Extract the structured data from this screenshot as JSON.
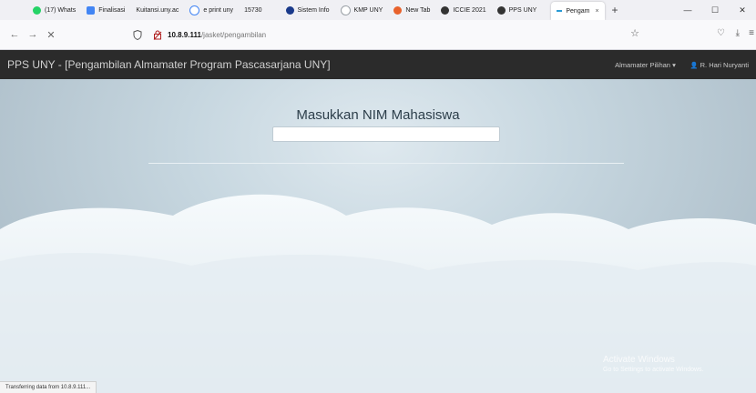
{
  "browser": {
    "tabs": [
      {
        "label": "(17) Whats",
        "color": "#25d366"
      },
      {
        "label": "Finalisasi",
        "color": "#4285f4"
      },
      {
        "label": "Kuitansi.uny.ac",
        "color": "#9aa0a6"
      },
      {
        "label": "e print uny",
        "color": "#4285f4"
      },
      {
        "label": "15730",
        "color": "#9aa0a6"
      },
      {
        "label": "Sistem Info",
        "color": "#1a3a8a"
      },
      {
        "label": "KMP UNY",
        "color": "#9aa0a6"
      },
      {
        "label": "New Tab",
        "color": "#e8622c"
      },
      {
        "label": "ICCIE 2021",
        "color": "#333333"
      },
      {
        "label": "PPS UNY",
        "color": "#333333"
      },
      {
        "label": "Pengam",
        "color": "#2a9bd5"
      }
    ],
    "tab_close": "×",
    "new_tab": "+",
    "window_controls": {
      "minimize": "—",
      "maximize": "☐",
      "close": "✕"
    },
    "nav": {
      "back": "←",
      "forward": "→",
      "stop": "✕"
    },
    "url_host": "10.8.9.111",
    "url_path": "/jasket/pengambilan",
    "bookmark_star": "☆",
    "pocket_icon": "♡",
    "download_icon": "⤓",
    "menu_icon": "≡"
  },
  "app": {
    "brand": "PPS UNY - [Pengambilan Almamater Program Pascasarjana UNY]",
    "menu_almamater": "Almamater Pilihan",
    "caret": "▾",
    "user_icon": "👤",
    "user_name": "R. Hari Nuryanti"
  },
  "main": {
    "title": "Masukkan NIM Mahasiswa",
    "nim_value": ""
  },
  "overlay": {
    "activate_title": "Activate Windows",
    "activate_sub": "Go to Settings to activate Windows."
  },
  "status_bar": "Transferring data from 10.8.9.111..."
}
